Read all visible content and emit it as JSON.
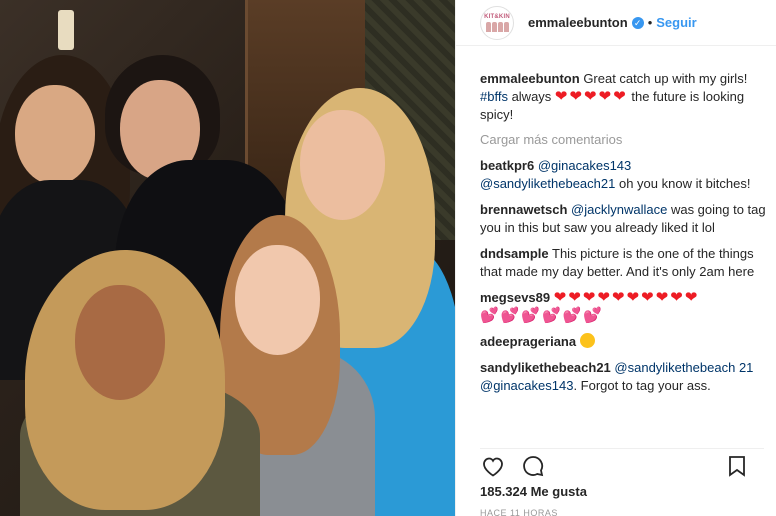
{
  "post": {
    "photo_alt": "",
    "username": "emmaleebunton",
    "verified": true,
    "follow_label": "Seguir",
    "avatar_brand": "KIT&KIN",
    "caption": {
      "user": "emmaleebunton",
      "text_a": "Great catch up with my girls! ",
      "hashtag": "#bffs",
      "text_b": " always ",
      "hearts": "❤❤❤❤❤",
      "text_c": " the future is looking spicy!"
    },
    "load_more_label": "Cargar más comentarios",
    "comments": [
      {
        "user": "beatkpr6",
        "mention": "@ginacakes143",
        "mention2": "@sandylikethebeach21",
        "text": " oh you know it bitches!"
      },
      {
        "user": "brennawetsch",
        "mention": "@jacklynwallace",
        "text": " was going to tag you in this but saw you already liked it lol"
      },
      {
        "user": "dndsample",
        "text": "This picture is the one of the things that made my day better. And it's only 2am here"
      },
      {
        "user": "megsevs89",
        "hearts1": "❤❤❤❤❤❤❤❤❤❤",
        "hearts2": "💕💕💕💕💕💕"
      },
      {
        "user": "adeeprageriana",
        "emoji": "heart-eyes"
      },
      {
        "user": "sandylikethebeach21",
        "mention": "@sandylikethebeach",
        "mention2": "21 @ginacakes143",
        "text": ". Forgot to tag your ass."
      }
    ],
    "likes": "185.324 Me gusta",
    "time": "HACE 11 HORAS"
  },
  "colors": {
    "accent": "#3897f0",
    "heart": "#ed1c24",
    "mention": "#003569"
  }
}
